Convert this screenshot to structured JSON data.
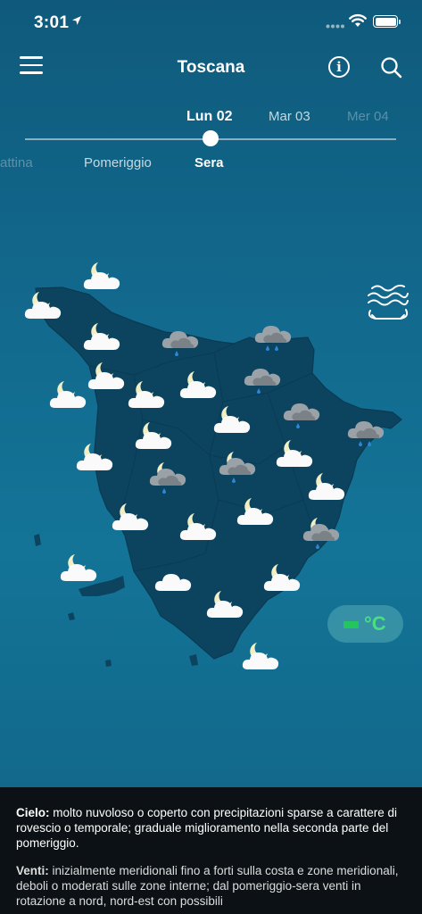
{
  "status_bar": {
    "time": "3:01"
  },
  "header": {
    "title": "Toscana"
  },
  "days": [
    {
      "label": "Lun 02",
      "selected": true
    },
    {
      "label": "Mar 03",
      "selected": false
    },
    {
      "label": "Mer 04",
      "selected": false
    }
  ],
  "periods": [
    {
      "label": "attina",
      "selected": false
    },
    {
      "label": "Pomeriggio",
      "selected": false
    },
    {
      "label": "Sera",
      "selected": true
    }
  ],
  "temperature_toggle": {
    "unit": "°C"
  },
  "forecast": {
    "cielo_label": "Cielo:",
    "cielo_text": " molto nuvoloso o coperto con precipitazioni sparse a carattere di rovescio o temporale; graduale miglioramento nella seconda parte del pomeriggio.",
    "venti_label": "Venti:",
    "venti_text": " inizialmente meridionali fino a forti sulla costa e zone meridionali, deboli o moderati sulle zone interne; dal pomeriggio-sera venti in rotazione a nord, nord-est con possibili"
  },
  "map_icons": [
    "moon-cloud",
    "moon-cloud",
    "moon-cloud",
    "rain-cloud",
    "rain-cloud",
    "moon-cloud",
    "moon-cloud",
    "moon-cloud",
    "moon-cloud",
    "rain-cloud",
    "moon-cloud",
    "rain-cloud",
    "rain-cloud",
    "moon-cloud",
    "moon-cloud",
    "moon-cloud",
    "moon-cloud",
    "moon-cloud",
    "moon-cloud",
    "moon-cloud",
    "moon-cloud",
    "moon-cloud",
    "moon-cloud",
    "moon-rain-cloud",
    "moon-rain-cloud",
    "moon-rain-cloud",
    "cloud",
    "moon-cloud",
    "cloud",
    "moon-cloud"
  ]
}
